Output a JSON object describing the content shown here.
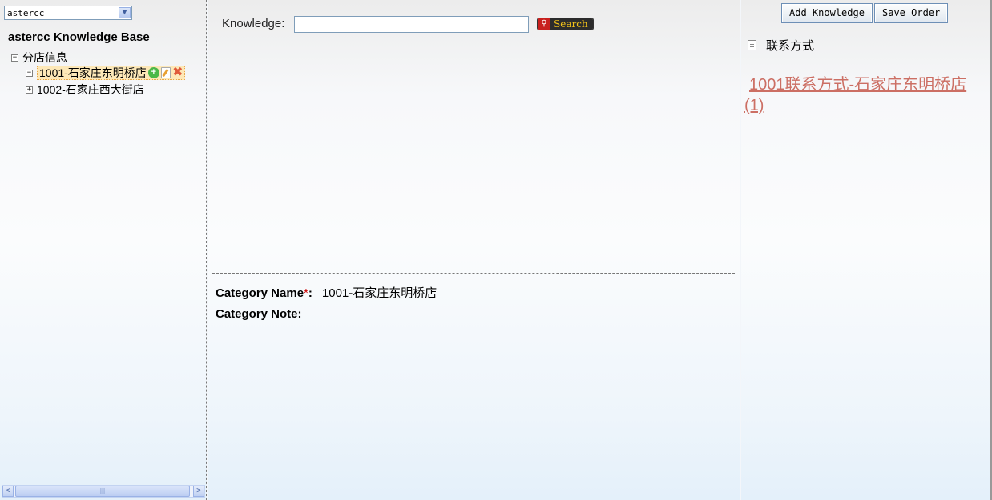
{
  "left": {
    "project_select": "astercc",
    "kb_title": "astercc Knowledge Base",
    "tree": {
      "root": {
        "toggle": "−",
        "label": "分店信息"
      },
      "children": [
        {
          "toggle": "−",
          "label": "1001-石家庄东明桥店",
          "selected": true
        },
        {
          "toggle": "+",
          "label": "1002-石家庄西大街店",
          "selected": false
        }
      ]
    },
    "scrollbar": {
      "left_arrow": "<",
      "right_arrow": ">",
      "grip": "|||"
    }
  },
  "center": {
    "search": {
      "label": "Knowledge:",
      "value": "",
      "button_label": "Search"
    },
    "category": {
      "name_label": "Category Name",
      "required_mark": "*",
      "name_suffix": ":",
      "name_value": "1001-石家庄东明桥店",
      "note_label": "Category Note:",
      "note_value": ""
    }
  },
  "right": {
    "add_button": "Add Knowledge",
    "save_button": "Save Order",
    "doc_label": "联系方式",
    "knowledge_link": "1001联系方式-石家庄东明桥店(1)",
    "colors": {
      "link": "#cc6f64",
      "selected_bg": "#fde8b8"
    }
  }
}
